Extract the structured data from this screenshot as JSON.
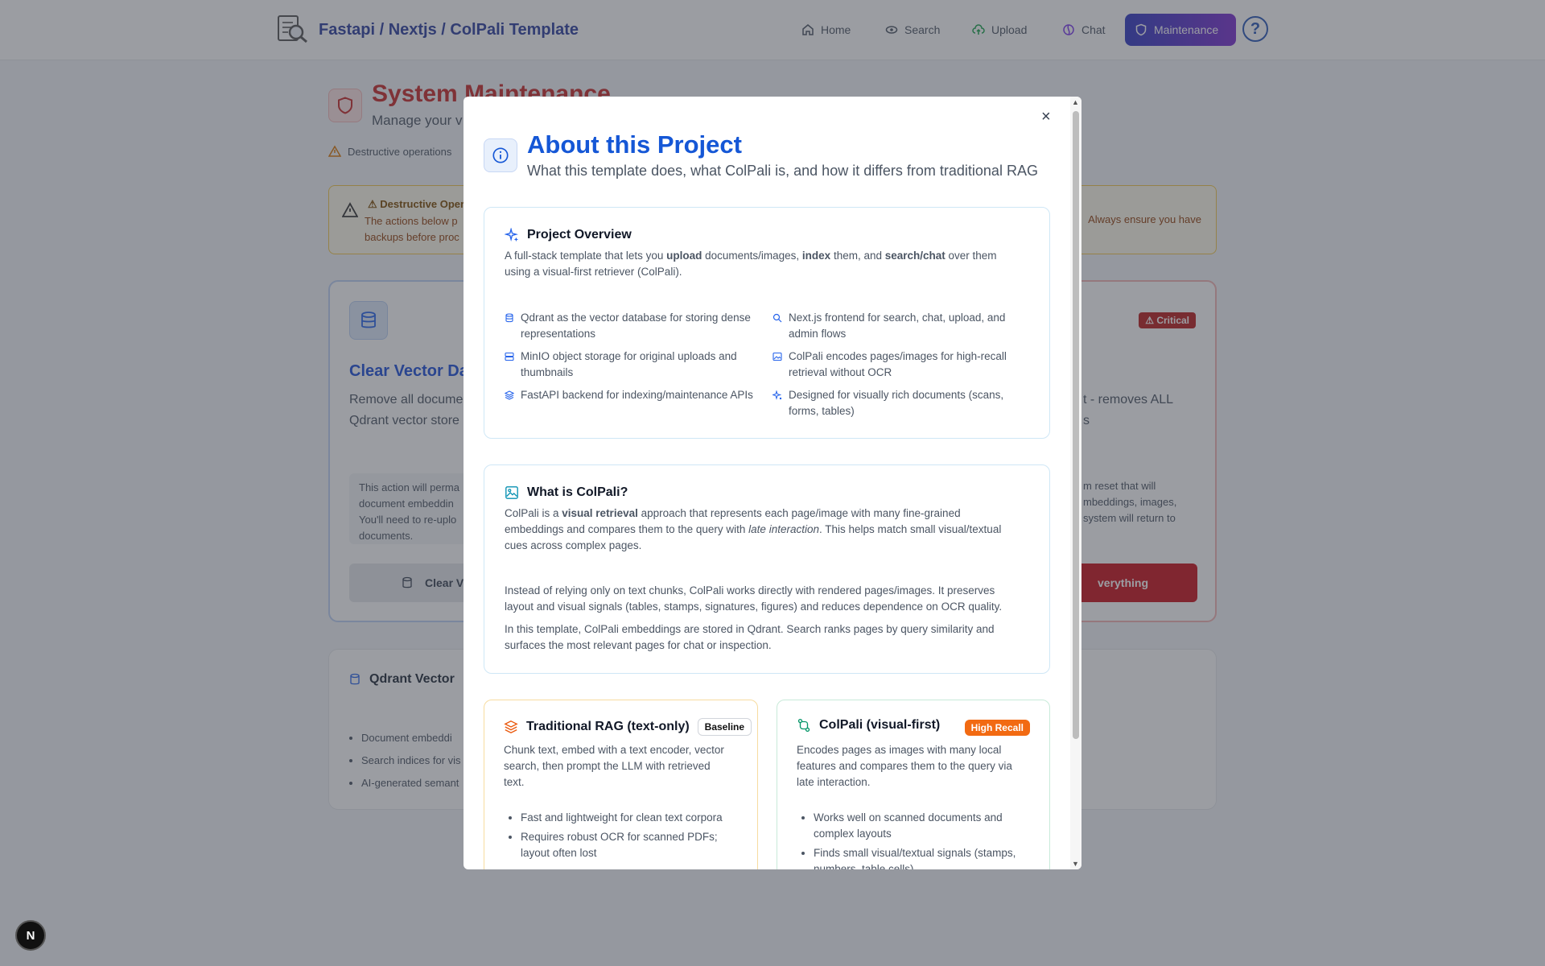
{
  "header": {
    "brand": "Fastapi / Nextjs / ColPali Template",
    "nav": [
      {
        "label": "Home",
        "icon": "home-icon"
      },
      {
        "label": "Search",
        "icon": "eye-icon"
      },
      {
        "label": "Upload",
        "icon": "cloud-upload-icon"
      },
      {
        "label": "Chat",
        "icon": "chat-icon"
      },
      {
        "label": "Maintenance",
        "icon": "shield-icon"
      }
    ],
    "help_label": "?"
  },
  "background": {
    "title": "System Maintenance",
    "subtitle": "Manage your v",
    "warning_line": "Destructive operations",
    "alert_title": "Destructive Oper",
    "alert_text_left": "The actions below p",
    "alert_text_left2": "backups before proc",
    "alert_text_right": "Always ensure you have",
    "card1_title": "Clear Vector Da",
    "card1_desc1": "Remove all documen",
    "card1_desc2": "Qdrant vector store",
    "card1_note1": "This action will perma",
    "card1_note2": "document embeddin",
    "card1_note3": "You'll need to re-uplo",
    "card1_note4": "documents.",
    "card1_button": "Clear V",
    "card2_badge": "Critical",
    "card2_desc1": "t - removes ALL",
    "card2_desc2": "s",
    "card2_note1": "m reset that will",
    "card2_note2": "mbeddings, images,",
    "card2_note3": "system will return to",
    "card2_button": "verything",
    "card3_title": "Qdrant Vector",
    "card3_items": [
      "Document embeddi",
      "Search indices for vis",
      "AI-generated semant"
    ]
  },
  "modal": {
    "close": "×",
    "title": "About this Project",
    "subtitle": "What this template does, what ColPali is, and how it differs from traditional RAG",
    "overview": {
      "heading": "Project Overview",
      "intro": {
        "p1": "A full-stack template that lets you ",
        "b1": "upload",
        "p2": " documents/images, ",
        "b2": "index",
        "p3": " them, and ",
        "b3": "search/chat",
        "p4": " over them",
        "line2": "using a visual-first retriever (ColPali)."
      },
      "features_left": [
        {
          "l1": "Qdrant as the vector database for storing dense",
          "l2": "representations"
        },
        {
          "l1": "MinIO object storage for original uploads and",
          "l2": "thumbnails"
        },
        {
          "l1": "FastAPI backend for indexing/maintenance APIs",
          "l2": ""
        }
      ],
      "features_right": [
        {
          "l1": "Next.js frontend for search, chat, upload, and",
          "l2": "admin flows"
        },
        {
          "l1": "ColPali encodes pages/images for high-recall",
          "l2": "retrieval without OCR"
        },
        {
          "l1": "Designed for visually rich documents (scans,",
          "l2": "forms, tables)"
        }
      ]
    },
    "colpali": {
      "heading": "What is ColPali?",
      "p1a": "ColPali is a ",
      "p1b": "visual retrieval",
      "p1c": " approach that represents each page/image with many fine-grained",
      "p1d": "embeddings and compares them to the query with ",
      "p1e": "late interaction",
      "p1f": ". This helps match small visual/textual",
      "p1g": "cues across complex pages.",
      "p2a": "Instead of relying only on text chunks, ColPali works directly with rendered pages/images. It preserves",
      "p2b": "layout and visual signals (tables, stamps, signatures, figures) and reduces dependence on OCR quality.",
      "p3a": "In this template, ColPali embeddings are stored in Qdrant. Search ranks pages by query similarity and",
      "p3b": "surfaces the most relevant pages for chat or inspection."
    },
    "rag": {
      "heading": "Traditional RAG (text-only)",
      "badge": "Baseline",
      "d1": "Chunk text, embed with a text encoder, vector",
      "d2": "search, then prompt the LLM with retrieved",
      "d3": "text.",
      "b1": "Fast and lightweight for clean text corpora",
      "b2a": "Requires robust OCR for scanned PDFs;",
      "b2b": "layout often lost"
    },
    "visual": {
      "heading": "ColPali (visual-first)",
      "badge": "High Recall",
      "d1": "Encodes pages as images with many local",
      "d2": "features and compares them to the query via",
      "d3": "late interaction.",
      "b1a": "Works well on scanned documents and",
      "b1b": "complex layouts",
      "b2a": "Finds small visual/textual signals (stamps,",
      "b2b": "numbers, table cells)"
    }
  },
  "dev_badge": "N",
  "colors": {
    "accent": "#1557d6",
    "danger": "#c62828",
    "maint_start": "#2f3ac2",
    "maint_end": "#7c2fd0",
    "badge_orange": "#f26a12"
  }
}
